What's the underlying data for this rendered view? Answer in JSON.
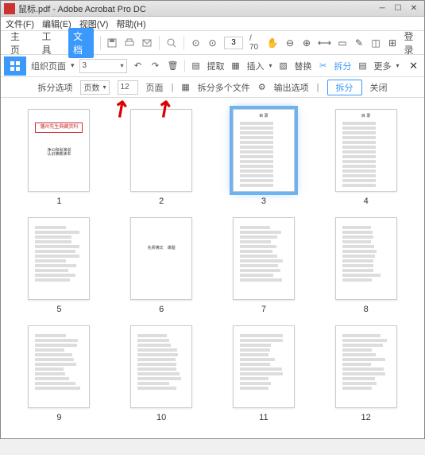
{
  "title": "鼠标.pdf - Adobe Acrobat Pro DC",
  "menubar": [
    "文件(F)",
    "编辑(E)",
    "视图(V)",
    "帮助(H)"
  ],
  "toolbar1": {
    "tabs": [
      "主页",
      "工具",
      "文档"
    ],
    "page_input": "3",
    "login": "登录"
  },
  "toolbar2": {
    "organize": "组织页面",
    "page_sel_value": "3",
    "extract": "提取",
    "insert": "插入",
    "replace": "替换",
    "split": "拆分",
    "more": "更多"
  },
  "toolbar3": {
    "label_options": "拆分选项",
    "split_mode_value": "页数",
    "split_count_value": "12",
    "pages_label": "页面",
    "split_multi": "拆分多个文件",
    "output_options": "输出选项",
    "split_btn": "拆分",
    "close_btn": "关闭"
  },
  "thumbs": {
    "count": 12,
    "selected": 3,
    "page1_title": "藩州先生典藏资料",
    "page1_sub1": "净公和尚演说",
    "page1_sub2": "认识佛教读本",
    "page6_txt": "先师佛文　课题"
  }
}
